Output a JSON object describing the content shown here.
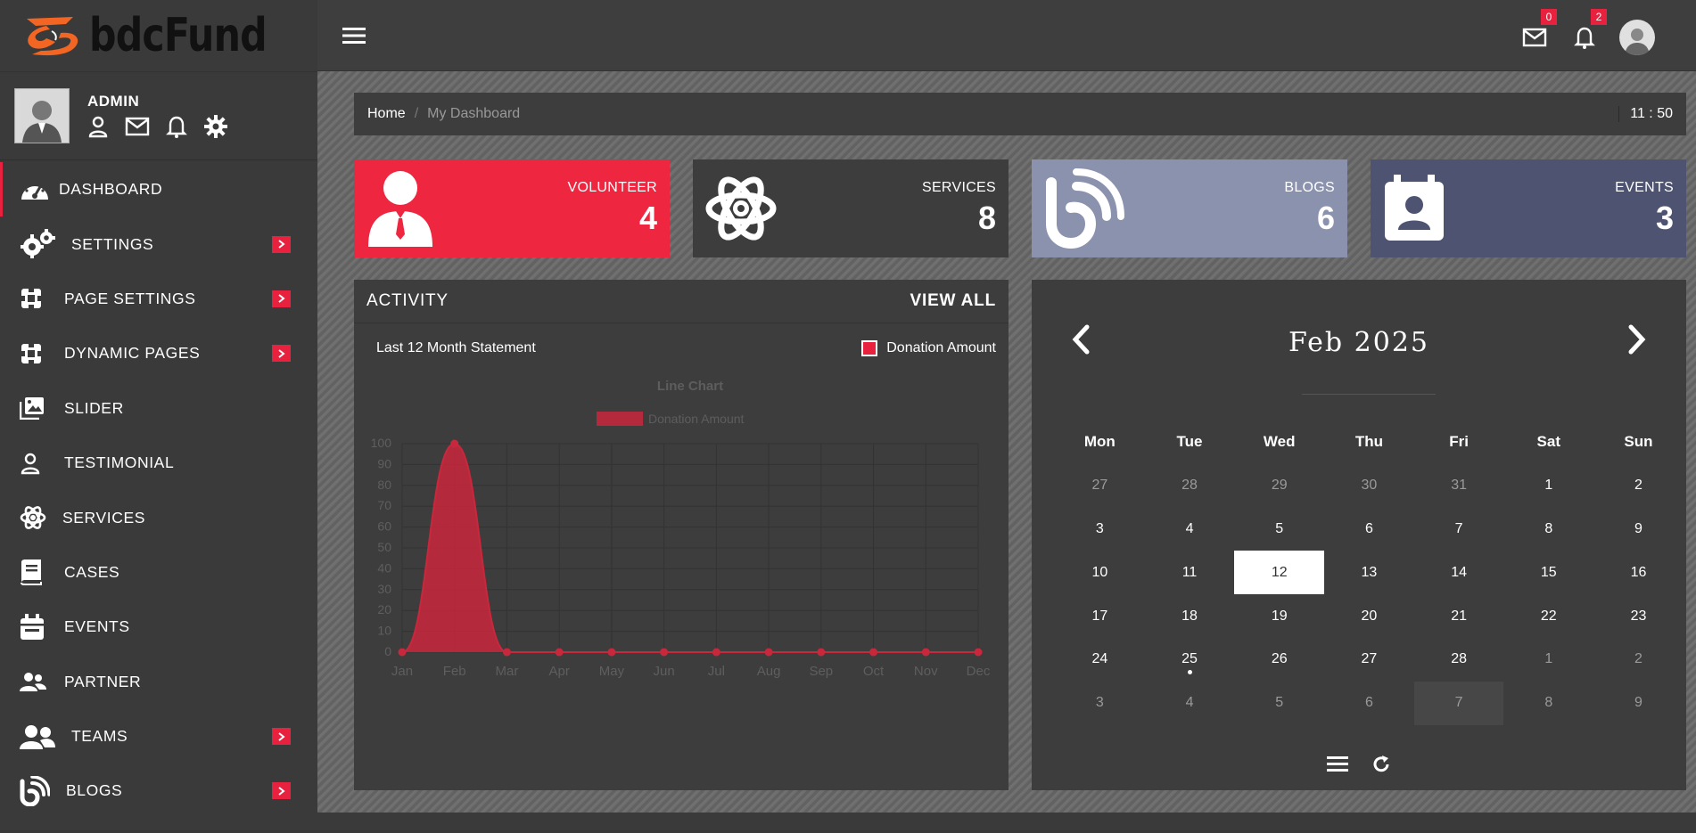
{
  "brand": {
    "name": "bdcFund",
    "accent": "#e8213f"
  },
  "user": {
    "name": "ADMIN"
  },
  "sidebar": {
    "items": [
      {
        "label": "DASHBOARD",
        "icon": "dashboard-gauge-icon",
        "active": true
      },
      {
        "label": "SETTINGS",
        "icon": "gears-icon",
        "submenu": true
      },
      {
        "label": "PAGE SETTINGS",
        "icon": "puzzle-icon",
        "submenu": true
      },
      {
        "label": "DYNAMIC PAGES",
        "icon": "puzzle-icon",
        "submenu": true
      },
      {
        "label": "SLIDER",
        "icon": "images-icon"
      },
      {
        "label": "TESTIMONIAL",
        "icon": "person-icon"
      },
      {
        "label": "SERVICES",
        "icon": "atom-icon"
      },
      {
        "label": "CASES",
        "icon": "book-icon"
      },
      {
        "label": "EVENTS",
        "icon": "calendar-icon"
      },
      {
        "label": "PARTNER",
        "icon": "people-icon"
      },
      {
        "label": "TEAMS",
        "icon": "users-icon",
        "submenu": true
      },
      {
        "label": "BLOGS",
        "icon": "blog-icon",
        "submenu": true
      }
    ]
  },
  "topbar": {
    "mail_count": "0",
    "notification_count": "2"
  },
  "breadcrumb": {
    "home": "Home",
    "separator": "/",
    "current": "My Dashboard",
    "time": "11 : 50"
  },
  "stats": [
    {
      "label": "VOLUNTEER",
      "value": "4",
      "color": "#ee2640"
    },
    {
      "label": "SERVICES",
      "value": "8",
      "color": "#3d3d3d"
    },
    {
      "label": "BLOGS",
      "value": "6",
      "color": "#8a92ad"
    },
    {
      "label": "EVENTS",
      "value": "3",
      "color": "#4d5370"
    }
  ],
  "activity": {
    "title": "ACTIVITY",
    "view_all": "VIEW ALL",
    "subtitle": "Last 12 Month Statement",
    "legend": "Donation Amount"
  },
  "chart_data": {
    "type": "area",
    "title": "Line Chart",
    "categories": [
      "Jan",
      "Feb",
      "Mar",
      "Apr",
      "May",
      "Jun",
      "Jul",
      "Aug",
      "Sep",
      "Oct",
      "Nov",
      "Dec"
    ],
    "series": [
      {
        "name": "Donation Amount",
        "values": [
          0,
          100,
          0,
          0,
          0,
          0,
          0,
          0,
          0,
          0,
          0,
          0
        ]
      }
    ],
    "yticks": [
      "0",
      "10",
      "20",
      "30",
      "40",
      "50",
      "60",
      "70",
      "80",
      "90",
      "100"
    ],
    "ylim": [
      0,
      100
    ],
    "grid": true,
    "legend_position": "top",
    "color": "#c9273c"
  },
  "calendar": {
    "title": "Feb 2025",
    "weekdays": [
      "Mon",
      "Tue",
      "Wed",
      "Thu",
      "Fri",
      "Sat",
      "Sun"
    ],
    "weeks": [
      [
        {
          "d": "27",
          "m": true
        },
        {
          "d": "28",
          "m": true
        },
        {
          "d": "29",
          "m": true
        },
        {
          "d": "30",
          "m": true
        },
        {
          "d": "31",
          "m": true
        },
        {
          "d": "1"
        },
        {
          "d": "2"
        }
      ],
      [
        {
          "d": "3"
        },
        {
          "d": "4"
        },
        {
          "d": "5"
        },
        {
          "d": "6"
        },
        {
          "d": "7"
        },
        {
          "d": "8"
        },
        {
          "d": "9"
        }
      ],
      [
        {
          "d": "10"
        },
        {
          "d": "11"
        },
        {
          "d": "12",
          "today": true
        },
        {
          "d": "13"
        },
        {
          "d": "14"
        },
        {
          "d": "15"
        },
        {
          "d": "16"
        }
      ],
      [
        {
          "d": "17"
        },
        {
          "d": "18"
        },
        {
          "d": "19"
        },
        {
          "d": "20"
        },
        {
          "d": "21"
        },
        {
          "d": "22"
        },
        {
          "d": "23"
        }
      ],
      [
        {
          "d": "24"
        },
        {
          "d": "25",
          "dot": true
        },
        {
          "d": "26"
        },
        {
          "d": "27"
        },
        {
          "d": "28"
        },
        {
          "d": "1",
          "m": true
        },
        {
          "d": "2",
          "m": true
        }
      ],
      [
        {
          "d": "3",
          "m": true
        },
        {
          "d": "4",
          "m": true
        },
        {
          "d": "5",
          "m": true
        },
        {
          "d": "6",
          "m": true
        },
        {
          "d": "7",
          "m": true,
          "shade": true
        },
        {
          "d": "8",
          "m": true
        },
        {
          "d": "9",
          "m": true
        }
      ]
    ]
  }
}
